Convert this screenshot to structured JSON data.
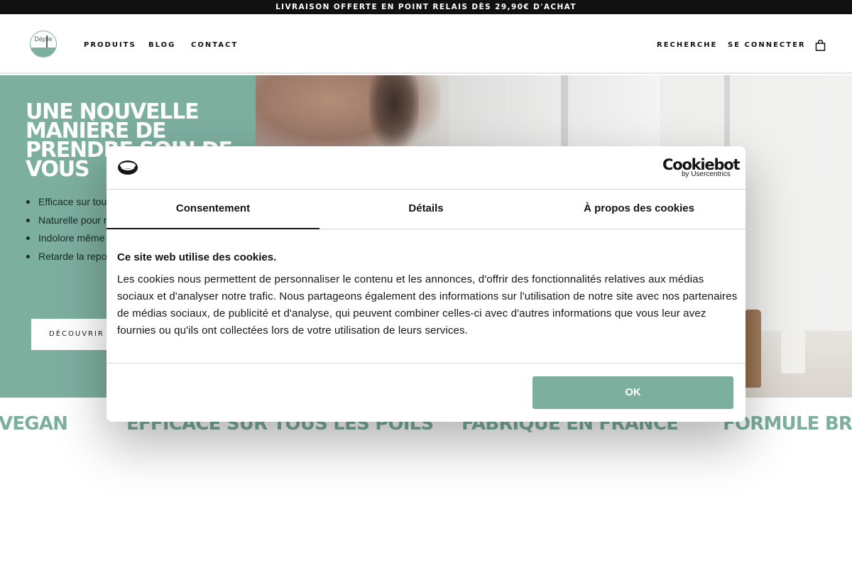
{
  "announcement": {
    "text": "LIVRAISON OFFERTE EN POINT RELAIS DÈS 29,90€ D'ACHAT"
  },
  "header": {
    "logo_text": "Dépile",
    "nav_left": [
      "PRODUITS",
      "BLOG",
      "CONTACT"
    ],
    "nav_right": [
      "RECHERCHE",
      "SE CONNECTER"
    ],
    "cart_icon": "shopping-bag-icon"
  },
  "hero": {
    "title": "UNE NOUVELLE MANIÈRE DE PRENDRE SOIN DE VOUS",
    "bullets": [
      "Efficace sur tous",
      "Naturelle pour r",
      "Indolore même s",
      "Retarde la repou dru"
    ],
    "button_label": "DÉCOUVRIR LA GAMME"
  },
  "features": [
    "VEGAN",
    "EFFICACE SUR TOUS LES POILS",
    "FABRIQUÉ EN FRANCE",
    "FORMULE BREVETÉE"
  ],
  "cookie_dialog": {
    "brand": "Cookiebot",
    "brand_sub": "by Usercentrics",
    "tabs": [
      "Consentement",
      "Détails",
      "À propos des cookies"
    ],
    "active_tab": "Consentement",
    "heading": "Ce site web utilise des cookies.",
    "body": "Les cookies nous permettent de personnaliser le contenu et les annonces, d'offrir des fonctionnalités relatives aux médias sociaux et d'analyser notre trafic. Nous partageons également des informations sur l'utilisation de notre site avec nos partenaires de médias sociaux, de publicité et d'analyse, qui peuvent combiner celles-ci avec d'autres informations que vous leur avez fournies ou qu'ils ont collectées lors de votre utilisation de leurs services.",
    "ok_label": "OK"
  },
  "colors": {
    "accent": "#7daf9f",
    "announcement_bg": "#111111",
    "text": "#141414"
  }
}
